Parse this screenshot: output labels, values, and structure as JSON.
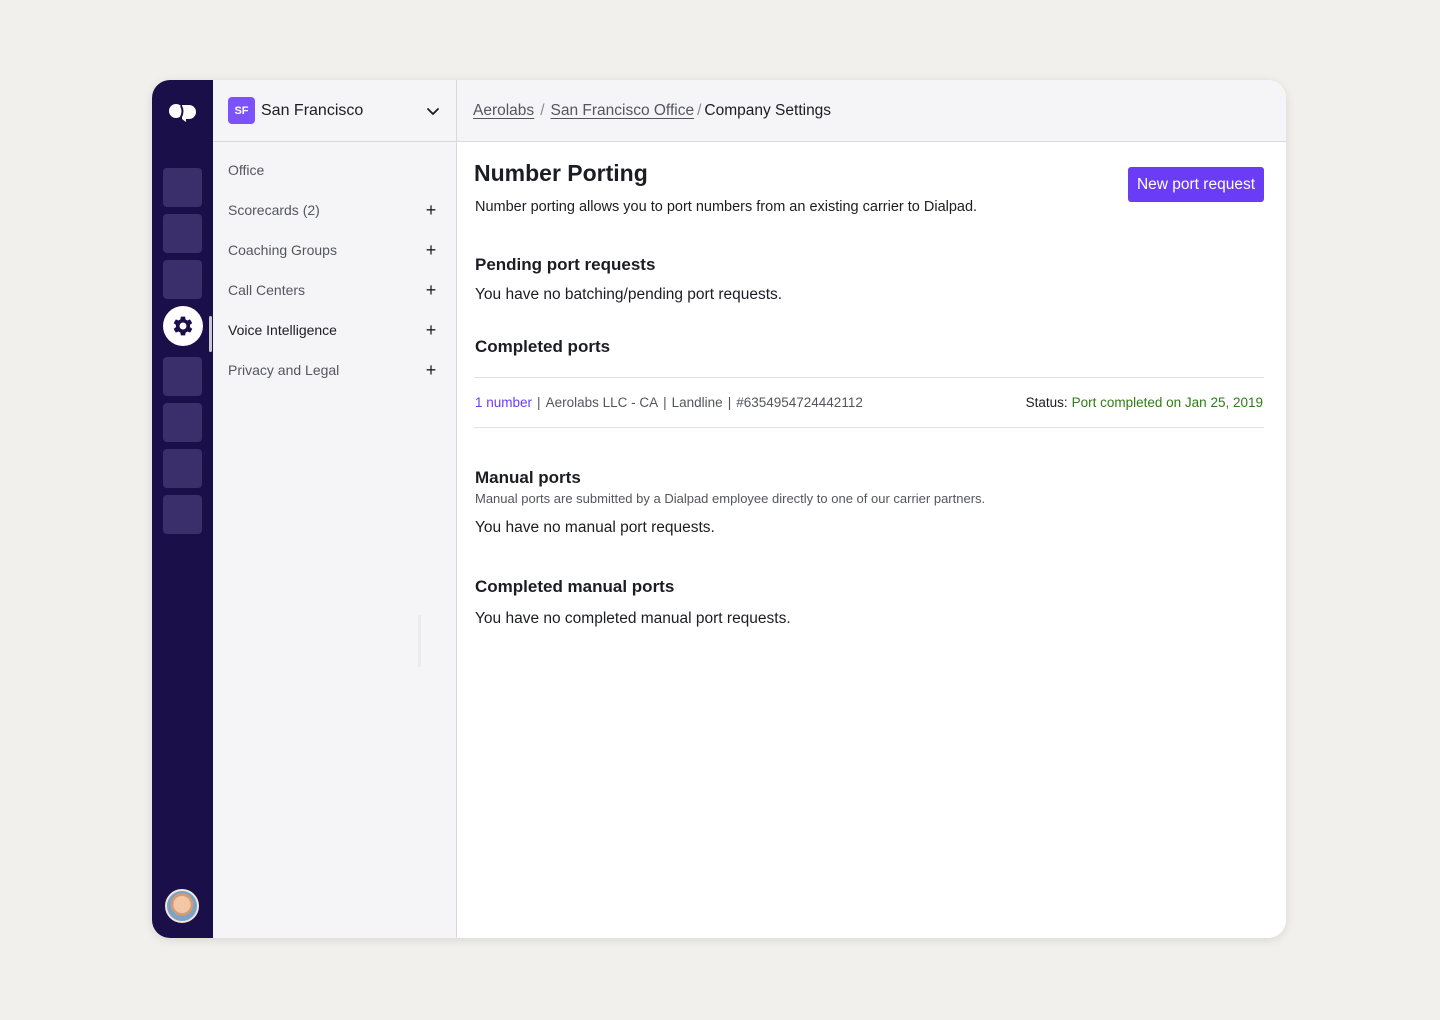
{
  "colors": {
    "rail_bg": "#1b0f4a",
    "accent": "#6b3cf6",
    "office_badge": "#7c52ff",
    "status_success": "#2e7d16"
  },
  "rail": {
    "logo_icon": "dialpad-logo-icon",
    "active_icon": "gear-icon"
  },
  "office": {
    "badge": "SF",
    "name": "San Francisco"
  },
  "sidebar": {
    "items": [
      {
        "label": "Office",
        "expandable": false
      },
      {
        "label": "Scorecards (2)",
        "expandable": true
      },
      {
        "label": "Coaching Groups",
        "expandable": true
      },
      {
        "label": "Call Centers",
        "expandable": true
      },
      {
        "label": "Voice Intelligence",
        "expandable": true,
        "active": true
      },
      {
        "label": "Privacy and Legal",
        "expandable": true
      }
    ],
    "plus": "+"
  },
  "breadcrumb": {
    "items": [
      "Aerolabs",
      "San Francisco Office",
      "Company Settings"
    ],
    "separator": "/"
  },
  "page": {
    "title": "Number Porting",
    "new_button": "New port request",
    "description": "Number porting allows you to port numbers from an existing carrier to Dialpad."
  },
  "pending": {
    "title": "Pending port requests",
    "empty": "You have no batching/pending port requests."
  },
  "completed": {
    "title": "Completed ports",
    "row": {
      "link": "1 number",
      "company": "Aerolabs LLC - CA",
      "type": "Landline",
      "id": "#6354954724442112",
      "status_label": "Status:",
      "status_value": "Port completed on Jan 25, 2019"
    }
  },
  "manual": {
    "title": "Manual ports",
    "subtitle": "Manual ports are submitted by a Dialpad employee directly to one of our carrier partners.",
    "empty": "You have no manual port requests."
  },
  "completed_manual": {
    "title": "Completed manual ports",
    "empty": "You have no completed manual port requests."
  }
}
